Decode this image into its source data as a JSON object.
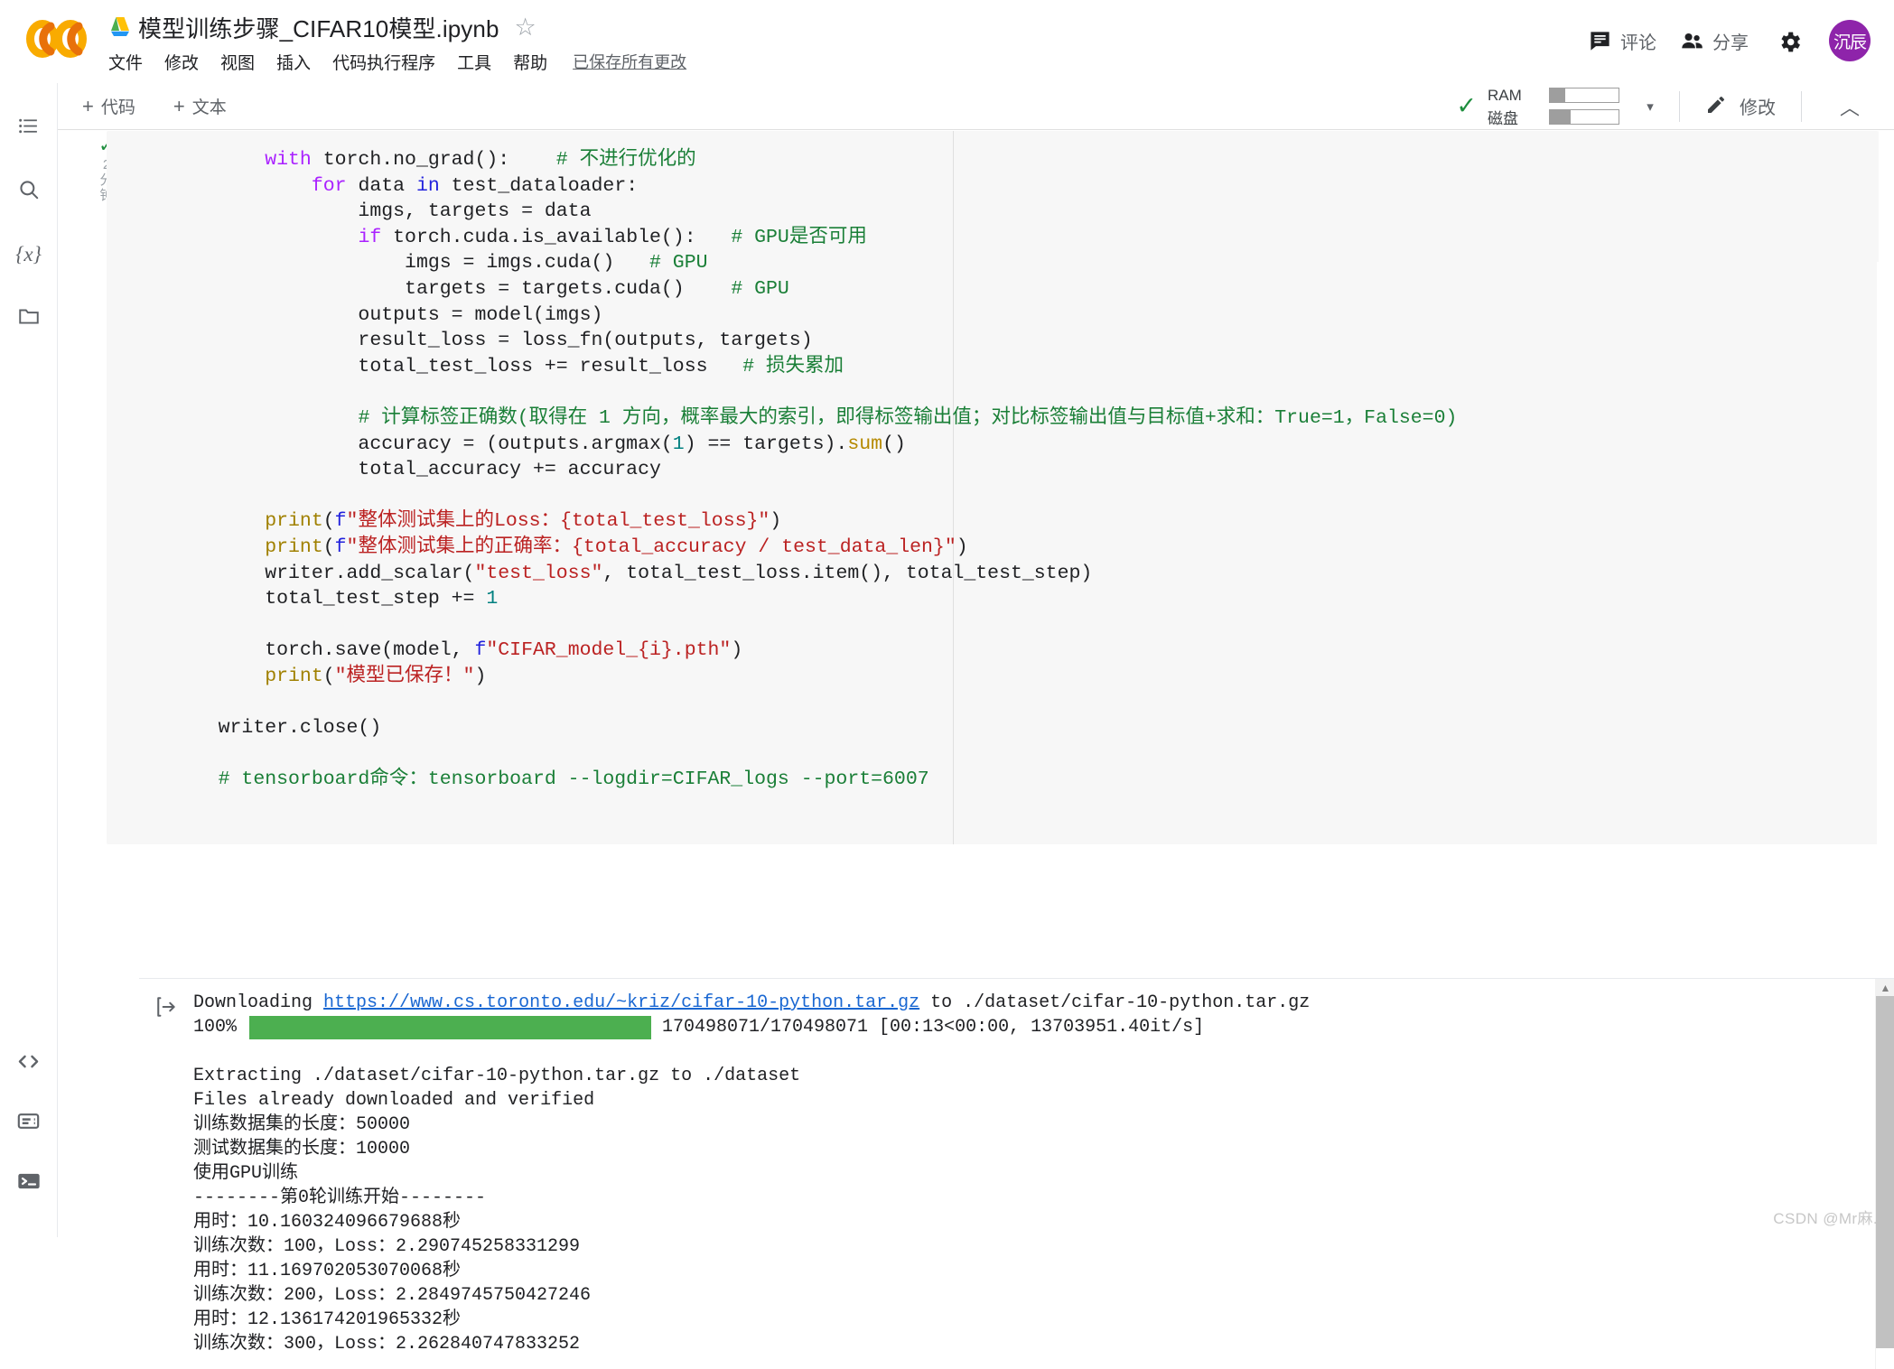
{
  "header": {
    "logo_alt": "colab-logo",
    "doc_title": "模型训练步骤_CIFAR10模型.ipynb",
    "star": "☆",
    "menu": [
      "文件",
      "修改",
      "视图",
      "插入",
      "代码执行程序",
      "工具",
      "帮助"
    ],
    "saved_note": "已保存所有更改",
    "comment_label": "评论",
    "share_label": "分享",
    "avatar_initials": "沉辰",
    "avatar_color": "#8E24AA"
  },
  "toolbar": {
    "add_code_label": "代码",
    "add_text_label": "文本",
    "plus": "+",
    "ram_label": "RAM",
    "disk_label": "磁盘",
    "ram_fill_pct": 22,
    "disk_fill_pct": 30,
    "edit_label": "修改",
    "connected_check": "✓",
    "caret": "▾",
    "collapse": "︿"
  },
  "sidebar": {
    "items": [
      {
        "name": "table-of-contents-icon",
        "glyph": "≔"
      },
      {
        "name": "search-icon",
        "glyph": "⌕"
      },
      {
        "name": "variables-icon",
        "glyph": "{x}"
      },
      {
        "name": "files-icon",
        "glyph": "▭"
      }
    ],
    "bottom_items": [
      {
        "name": "code-snippets-icon",
        "glyph": "<>"
      },
      {
        "name": "command-palette-icon",
        "glyph": "▤"
      },
      {
        "name": "terminal-icon",
        "glyph": ">_"
      }
    ]
  },
  "cell": {
    "status_check": "✓",
    "run_time": "2\n分\n钟",
    "run_button": "▶",
    "code_lines": [
      {
        "indent": 8,
        "parts": [
          {
            "t": "with",
            "c": "k"
          },
          {
            "t": " torch.no_grad():    "
          },
          {
            "t": "# 不进行优化的",
            "c": "c"
          }
        ]
      },
      {
        "indent": 12,
        "parts": [
          {
            "t": "for",
            "c": "k"
          },
          {
            "t": " data "
          },
          {
            "t": "in",
            "c": "kb"
          },
          {
            "t": " test_dataloader:"
          }
        ]
      },
      {
        "indent": 16,
        "parts": [
          {
            "t": "imgs, targets = data"
          }
        ]
      },
      {
        "indent": 16,
        "parts": [
          {
            "t": "if",
            "c": "k"
          },
          {
            "t": " torch.cuda.is_available():   "
          },
          {
            "t": "# GPU是否可用",
            "c": "c"
          }
        ]
      },
      {
        "indent": 20,
        "parts": [
          {
            "t": "imgs = imgs.cuda()   "
          },
          {
            "t": "# GPU",
            "c": "c"
          }
        ]
      },
      {
        "indent": 20,
        "parts": [
          {
            "t": "targets = targets.cuda()    "
          },
          {
            "t": "# GPU",
            "c": "c"
          }
        ]
      },
      {
        "indent": 16,
        "parts": [
          {
            "t": "outputs = model(imgs)"
          }
        ]
      },
      {
        "indent": 16,
        "parts": [
          {
            "t": "result_loss = loss_fn(outputs, targets)"
          }
        ]
      },
      {
        "indent": 16,
        "parts": [
          {
            "t": "total_test_loss += result_loss   "
          },
          {
            "t": "# 损失累加",
            "c": "c"
          }
        ]
      },
      {
        "indent": 0,
        "parts": []
      },
      {
        "indent": 16,
        "parts": [
          {
            "t": "# 计算标签正确数(取得在 1 方向，概率最大的索引，即得标签输出值；对比标签输出值与目标值+求和：True=1，False=0)",
            "c": "c"
          }
        ]
      },
      {
        "indent": 16,
        "parts": [
          {
            "t": "accuracy = (outputs.argmax("
          },
          {
            "t": "1",
            "c": "n"
          },
          {
            "t": ") == targets)."
          },
          {
            "t": "sum",
            "c": "nm"
          },
          {
            "t": "()"
          }
        ]
      },
      {
        "indent": 16,
        "parts": [
          {
            "t": "total_accuracy += accuracy"
          }
        ]
      },
      {
        "indent": 0,
        "parts": []
      },
      {
        "indent": 8,
        "parts": [
          {
            "t": "print",
            "c": "fn"
          },
          {
            "t": "("
          },
          {
            "t": "f",
            "c": "kb"
          },
          {
            "t": "\"整体测试集上的Loss：{total_test_loss}\"",
            "c": "s"
          },
          {
            "t": ")"
          }
        ]
      },
      {
        "indent": 8,
        "parts": [
          {
            "t": "print",
            "c": "fn"
          },
          {
            "t": "("
          },
          {
            "t": "f",
            "c": "kb"
          },
          {
            "t": "\"整体测试集上的正确率：{total_accuracy / test_data_len}\"",
            "c": "s"
          },
          {
            "t": ")"
          }
        ]
      },
      {
        "indent": 8,
        "parts": [
          {
            "t": "writer.add_scalar("
          },
          {
            "t": "\"test_loss\"",
            "c": "s"
          },
          {
            "t": ", total_test_loss.item(), total_test_step)"
          }
        ]
      },
      {
        "indent": 8,
        "parts": [
          {
            "t": "total_test_step += "
          },
          {
            "t": "1",
            "c": "n"
          }
        ]
      },
      {
        "indent": 0,
        "parts": []
      },
      {
        "indent": 8,
        "parts": [
          {
            "t": "torch.save(model, "
          },
          {
            "t": "f",
            "c": "kb"
          },
          {
            "t": "\"CIFAR_model_{i}.pth\"",
            "c": "s"
          },
          {
            "t": ")"
          }
        ]
      },
      {
        "indent": 8,
        "parts": [
          {
            "t": "print",
            "c": "fn"
          },
          {
            "t": "("
          },
          {
            "t": "\"模型已保存！\"",
            "c": "s"
          },
          {
            "t": ")"
          }
        ]
      },
      {
        "indent": 0,
        "parts": []
      },
      {
        "indent": 4,
        "parts": [
          {
            "t": "writer.close()"
          }
        ]
      },
      {
        "indent": 0,
        "parts": []
      },
      {
        "indent": 4,
        "parts": [
          {
            "t": "# tensorboard命令：tensorboard --logdir=CIFAR_logs --port=6007",
            "c": "c"
          }
        ]
      }
    ]
  },
  "output": {
    "download_prefix": "Downloading ",
    "download_url": "https://www.cs.toronto.edu/~kriz/cifar-10-python.tar.gz",
    "download_suffix": " to ./dataset/cifar-10-python.tar.gz",
    "progress_pct": "100%",
    "progress_bar_pct": 100,
    "progress_text": "170498071/170498071 [00:13<00:00, 13703951.40it/s]",
    "lines": [
      "Extracting ./dataset/cifar-10-python.tar.gz to ./dataset",
      "Files already downloaded and verified",
      "训练数据集的长度：50000",
      "测试数据集的长度：10000",
      "使用GPU训练",
      "--------第0轮训练开始--------",
      "用时：10.160324096679688秒",
      "训练次数：100，Loss：2.290745258331299",
      "用时：11.169702053070068秒",
      "训练次数：200，Loss：2.2849745750427246",
      "用时：12.136174201965332秒",
      "训练次数：300，Loss：2.262840747833252"
    ]
  },
  "watermark": "CSDN @Mr麻."
}
